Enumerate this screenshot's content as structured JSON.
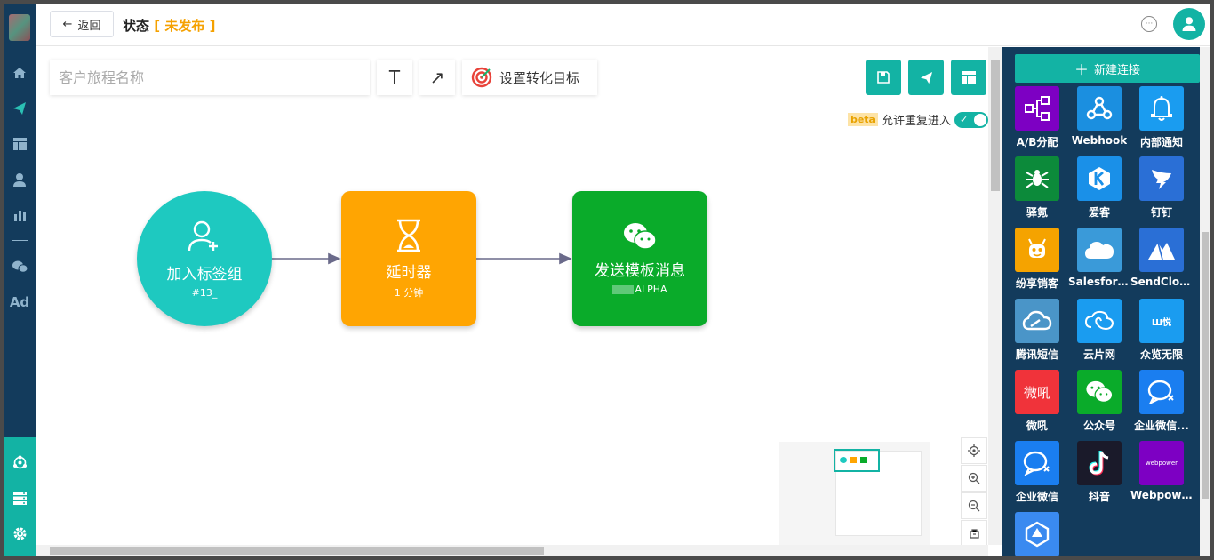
{
  "header": {
    "back_label": "返回",
    "status_label": "状态",
    "status_value": "未发布"
  },
  "toolbar": {
    "name_placeholder": "客户旅程名称",
    "text_tool": "T",
    "arrow_tool": "↗",
    "goal_label": "设置转化目标"
  },
  "options": {
    "beta_badge": "beta",
    "reentry_label": "允许重复进入",
    "reentry_enabled": true
  },
  "nodes": [
    {
      "title": "加入标签组",
      "sub": "#13_",
      "color": "#1ec9c0",
      "icon": "user-add-icon"
    },
    {
      "title": "延时器",
      "sub": "1 分钟",
      "color": "#ffa502",
      "icon": "hourglass-icon"
    },
    {
      "title": "发送模板消息",
      "sub": "ALPHA",
      "color": "#0aab2a",
      "icon": "wechat-icon"
    }
  ],
  "panel": {
    "new_connection_label": "新建连接",
    "connectors": [
      {
        "label": "A/B分配",
        "color": "#7d00c3",
        "icon": "ab-split-icon"
      },
      {
        "label": "Webhook",
        "color": "#1b8fe0",
        "icon": "webhook-icon"
      },
      {
        "label": "内部通知",
        "color": "#1a9cf0",
        "icon": "bell-icon"
      },
      {
        "label": "驿氪",
        "color": "#0c8a3a",
        "icon": "spider-icon"
      },
      {
        "label": "爱客",
        "color": "#1a90e8",
        "icon": "aike-icon"
      },
      {
        "label": "钉钉",
        "color": "#2a6fd6",
        "icon": "dingtalk-icon"
      },
      {
        "label": "纷享销客",
        "color": "#f5a300",
        "icon": "fxiaoke-icon"
      },
      {
        "label": "Salesforce",
        "color": "#3a9ad9",
        "icon": "cloud-icon"
      },
      {
        "label": "SendCloud",
        "color": "#2a6fd6",
        "icon": "sendcloud-icon"
      },
      {
        "label": "腾讯短信",
        "color": "#4a95c8",
        "icon": "tencent-cloud-icon"
      },
      {
        "label": "云片网",
        "color": "#1a9cf0",
        "icon": "yunpian-icon"
      },
      {
        "label": "众览无限",
        "color": "#1a9cf0",
        "icon": "zhonglan-icon"
      },
      {
        "label": "微吼",
        "color": "#f0333a",
        "icon": "vhall-icon"
      },
      {
        "label": "公众号",
        "color": "#0aab2a",
        "icon": "wechat-icon"
      },
      {
        "label": "企业微信...",
        "color": "#1a7ef0",
        "icon": "wework-icon"
      },
      {
        "label": "企业微信",
        "color": "#1a7ef0",
        "icon": "wework-icon"
      },
      {
        "label": "抖音",
        "color": "#1a1a2a",
        "icon": "tiktok-icon"
      },
      {
        "label": "Webpower",
        "color": "#7d00c3",
        "icon": "webpower-icon"
      },
      {
        "label": "",
        "color": "#3a8af0",
        "icon": "hexagon-icon"
      }
    ],
    "tile_texts": {
      "vhall": "微吼",
      "zhonglan": "Ш悦",
      "webpower": "webpower"
    }
  },
  "nav": {
    "ad_label": "Ad"
  },
  "colors": {
    "teal": "#13b3a4",
    "nav_bg": "#133b5c",
    "orange": "#ffa502",
    "green": "#0aab2a"
  }
}
